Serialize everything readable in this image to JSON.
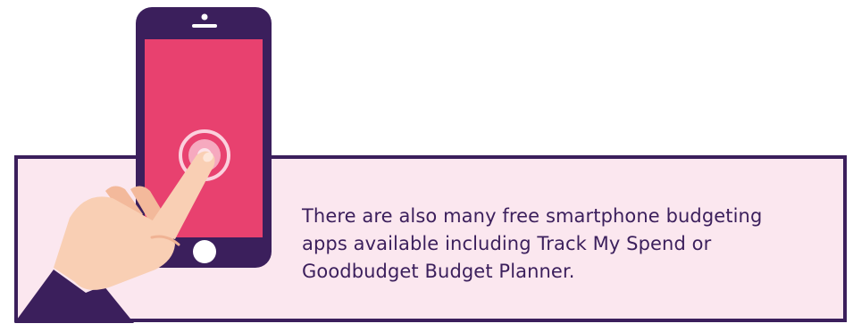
{
  "callout": {
    "text_lines": [
      "There are also many free smartphone budgeting",
      "apps available including Track My Spend or",
      "Goodbudget Budget Planner."
    ]
  },
  "illustration": {
    "phone_icon": "smartphone-icon",
    "hand_icon": "pointing-hand-icon",
    "tap_icon": "tap-ripple-icon"
  },
  "colors": {
    "brand_purple": "#3b1f5c",
    "screen_pink": "#e8416f",
    "box_background": "#fbe7ef",
    "skin": "#f9cfb4"
  }
}
